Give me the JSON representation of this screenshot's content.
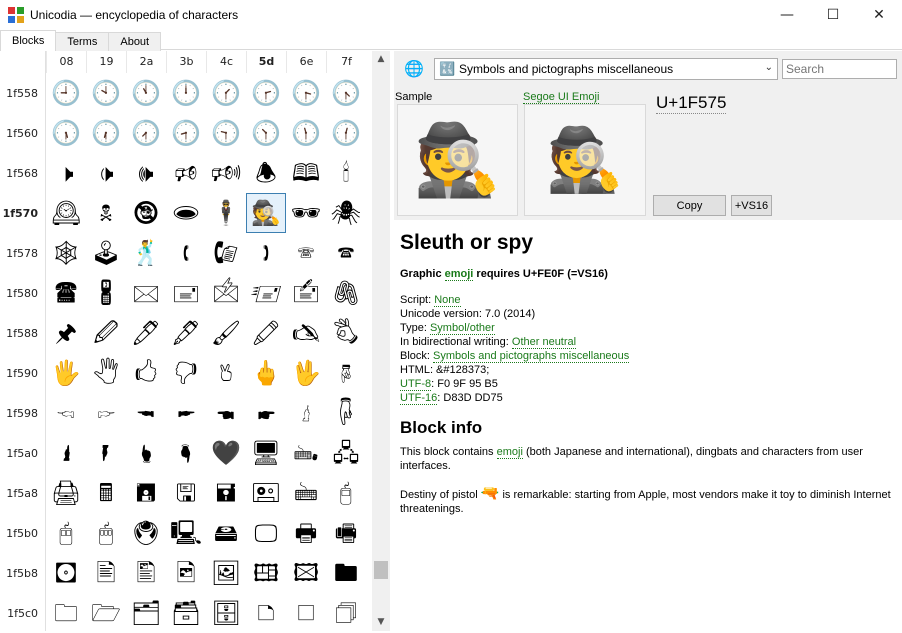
{
  "window": {
    "title": "Unicodia — encyclopedia of characters",
    "minimize": "—",
    "maximize": "☐",
    "close": "✕"
  },
  "tabs": [
    {
      "label": "Blocks"
    },
    {
      "label": "Terms"
    },
    {
      "label": "About"
    }
  ],
  "grid": {
    "columns": [
      "08",
      "19",
      "2a",
      "3b",
      "4c",
      "5d",
      "6e",
      "7f"
    ],
    "bold_column": "5d",
    "rows": [
      {
        "label": "1f558",
        "chars": [
          "🕘",
          "🕙",
          "🕚",
          "🕛",
          "🕜",
          "🕝",
          "🕞",
          "🕟"
        ]
      },
      {
        "label": "1f560",
        "chars": [
          "🕠",
          "🕡",
          "🕢",
          "🕣",
          "🕤",
          "🕥",
          "🕦",
          "🕧"
        ]
      },
      {
        "label": "1f568",
        "chars": [
          "🕨",
          "🕩",
          "🕪",
          "🕫",
          "🕬",
          "🕭",
          "🕮",
          "🕯"
        ]
      },
      {
        "label": "1f570",
        "chars": [
          "🕰",
          "🕱",
          "🕲",
          "🕳",
          "🕴",
          "🕵",
          "🕶",
          "🕷"
        ],
        "bold": true
      },
      {
        "label": "1f578",
        "chars": [
          "🕸",
          "🕹",
          "🕺",
          "🕻",
          "🕼",
          "🕽",
          "🕾",
          "🕿"
        ]
      },
      {
        "label": "1f580",
        "chars": [
          "🖀",
          "🖁",
          "🖂",
          "🖃",
          "🖄",
          "🖅",
          "🖆",
          "🖇"
        ]
      },
      {
        "label": "1f588",
        "chars": [
          "🖈",
          "🖉",
          "🖊",
          "🖋",
          "🖌",
          "🖍",
          "🖎",
          "🖏"
        ]
      },
      {
        "label": "1f590",
        "chars": [
          "🖐",
          "🖑",
          "🖒",
          "🖓",
          "🖔",
          "🖕",
          "🖖",
          "🖗"
        ]
      },
      {
        "label": "1f598",
        "chars": [
          "🖘",
          "🖙",
          "🖚",
          "🖛",
          "🖜",
          "🖝",
          "🖞",
          "🖟"
        ]
      },
      {
        "label": "1f5a0",
        "chars": [
          "🖠",
          "🖡",
          "🖢",
          "🖣",
          "🖤",
          "🖥",
          "🖦",
          "🖧"
        ]
      },
      {
        "label": "1f5a8",
        "chars": [
          "🖨",
          "🖩",
          "🖪",
          "🖫",
          "🖬",
          "🖭",
          "🖮",
          "🖯"
        ]
      },
      {
        "label": "1f5b0",
        "chars": [
          "🖰",
          "🖱",
          "🖲",
          "🖳",
          "🖴",
          "🖵",
          "🖶",
          "🖷"
        ]
      },
      {
        "label": "1f5b8",
        "chars": [
          "🖸",
          "🖹",
          "🖺",
          "🖻",
          "🖼",
          "🖽",
          "🖾",
          "🖿"
        ]
      },
      {
        "label": "1f5c0",
        "chars": [
          "🗀",
          "🗁",
          "🗂",
          "🗃",
          "🗄",
          "🗅",
          "🗆",
          "🗇"
        ]
      }
    ],
    "selected": {
      "row": 3,
      "col": 5
    }
  },
  "scroll": {
    "up": "▲",
    "down": "▼"
  },
  "toolbar": {
    "globe_icon": "🌐",
    "block_select_icon": "🔣",
    "block_select_value": "Symbols and pictographs miscellaneous",
    "block_select_arrow": "⌄",
    "search_placeholder": "Search"
  },
  "preview": {
    "sample_label": "Sample",
    "font_label": "Segoe UI Emoji",
    "sample_glyph": "🕵",
    "font_glyph": "🕵",
    "codepoint": "U+1F575",
    "copy_label": "Copy",
    "vs16_label": "+VS16"
  },
  "info": {
    "name": "Sleuth or spy",
    "graphic_pre": "Graphic ",
    "graphic_link": "emoji",
    "graphic_post": " requires U+FE0F (=VS16)",
    "script_label": "Script: ",
    "script_value": "None",
    "unicode_version": "Unicode version: 7.0 (2014)",
    "type_label": "Type: ",
    "type_value": "Symbol/other",
    "bidi_label": "In bidirectional writing: ",
    "bidi_value": "Other neutral",
    "block_label": "Block: ",
    "block_value": "Symbols and pictographs miscellaneous",
    "html": "HTML: &#128373;",
    "utf8_label": "UTF-8",
    "utf8_value": ": F0 9F 95 B5",
    "utf16_label": "UTF-16",
    "utf16_value": ": D83D DD75",
    "block_info_title": "Block info",
    "block_desc_pre": "This block contains ",
    "block_desc_link": "emoji",
    "block_desc_post": " (both Japanese and international), dingbats and characters from user interfaces.",
    "destiny_pre": "Destiny of pistol ",
    "destiny_glyph": "🔫",
    "destiny_post": " is remarkable: starting from Apple, most vendors make it toy to diminish Internet threatenings."
  }
}
